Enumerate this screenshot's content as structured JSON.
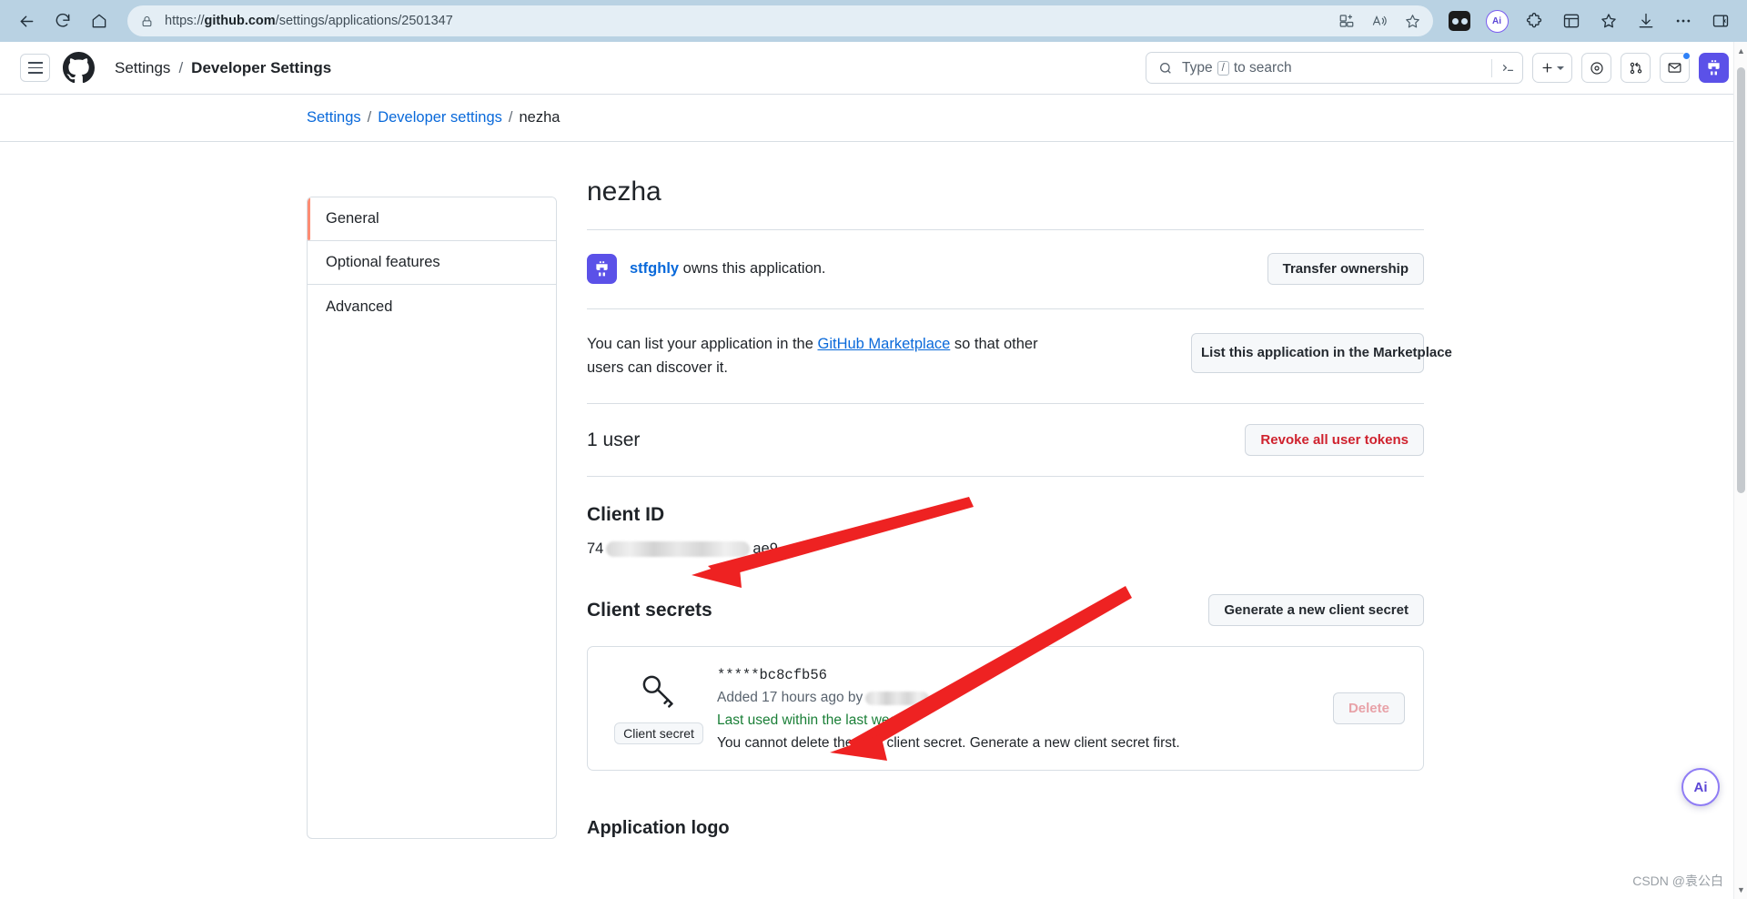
{
  "browser": {
    "url_prefix": "https://",
    "url_domain": "github.com",
    "url_path": "/settings/applications/2501347",
    "icons": {
      "back": "back-arrow-icon",
      "refresh": "refresh-icon",
      "home": "home-icon",
      "lock": "lock-icon",
      "split_screen": "split-screen-icon",
      "read_aloud": "read-aloud-icon",
      "favorite": "favorite-star-icon",
      "collections": "collections-icon",
      "copilot": "copilot-icon",
      "extensions": "extensions-icon",
      "browser_essentials": "browser-essentials-icon",
      "favorites_bar": "favorites-bar-icon",
      "downloads": "downloads-icon",
      "settings_more": "settings-and-more-icon",
      "sidebar": "sidebar-toggle-icon"
    }
  },
  "gh_header": {
    "menu_label": "open-menu",
    "breadcrumb_root": "Settings",
    "breadcrumb_sep": "/",
    "breadcrumb_current": "Developer Settings",
    "search_placeholder": "Type",
    "search_key": "/",
    "search_suffix": "to search",
    "create_new": "+",
    "badge_dot": true
  },
  "breadcrumb": {
    "settings": "Settings",
    "sep1": "/",
    "developer_settings": "Developer settings",
    "sep2": "/",
    "current": "nezha"
  },
  "sidebar": {
    "items": [
      {
        "label": "General",
        "active": true
      },
      {
        "label": "Optional features",
        "active": false
      },
      {
        "label": "Advanced",
        "active": false
      }
    ]
  },
  "main": {
    "app_name": "nezha",
    "owner": {
      "username": "stfghly",
      "suffix": " owns this application.",
      "transfer_button": "Transfer ownership"
    },
    "marketplace": {
      "text_before": "You can list your application in the ",
      "link": "GitHub Marketplace",
      "text_after": " so that other users can discover it.",
      "button": "List this application in the Marketplace"
    },
    "users": {
      "count_label": "1 user",
      "revoke_button": "Revoke all user tokens"
    },
    "client_id": {
      "heading": "Client ID",
      "value_prefix": "74",
      "value_suffix": "ae9",
      "redacted": true
    },
    "client_secrets": {
      "heading": "Client secrets",
      "generate_button": "Generate a new client secret",
      "secret": {
        "key_label": "Client secret",
        "masked_value": "*****bc8cfb56",
        "added_text": "Added 17 hours ago by",
        "added_by_redacted": true,
        "last_used": "Last used within the last week",
        "note": "You cannot delete the only client secret. Generate a new client secret first.",
        "delete_button": "Delete"
      }
    },
    "application_logo_heading": "Application logo"
  },
  "overlay": {
    "ai_button": "Ai",
    "watermark": "CSDN @袁公白"
  },
  "colors": {
    "accent_orange": "#fd8c73",
    "link_blue": "#0969da",
    "danger_red": "#cf222e",
    "success_green": "#1a7f37",
    "brand_purple": "#5b51e8",
    "annotation_red": "#ee2222",
    "chrome_blue": "#b9d2e3"
  }
}
